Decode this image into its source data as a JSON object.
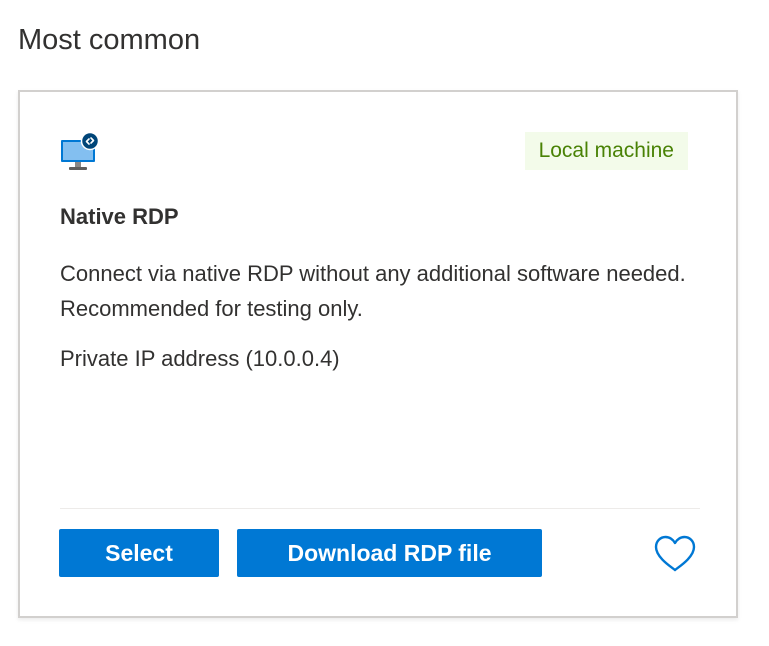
{
  "section": {
    "title": "Most common"
  },
  "card": {
    "icon": "virtual-machine-remote-icon",
    "badge": "Local machine",
    "title": "Native RDP",
    "description": "Connect via native RDP without any additional software needed. Recommended for testing only.",
    "ip_text": "Private IP address (10.0.0.4)",
    "buttons": {
      "select": "Select",
      "download": "Download RDP file"
    },
    "favorite_icon": "heart-outline-icon"
  },
  "colors": {
    "primary": "#0078d4",
    "badge_background": "#f3fbea",
    "badge_text": "#498205",
    "text": "#323130",
    "border": "#d2d0ce"
  }
}
